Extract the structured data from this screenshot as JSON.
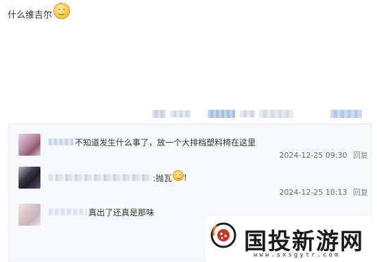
{
  "post": {
    "text": "什么维吉尔",
    "emoji_icon": "smiley-icon"
  },
  "comments": [
    {
      "text": "不知道发生什么事了，放一个大排档塑料椅在这里",
      "timestamp": "2024-12-25 09:30",
      "reply_label": "回复"
    },
    {
      "text": ":抛瓦",
      "text_after_emoji": "!",
      "timestamp": "2024-12-25 10:13",
      "reply_label": "回复"
    },
    {
      "text": "真出了还真是那味"
    }
  ],
  "watermark": {
    "brand": "国投新游网",
    "url": "www.sxsgytr.com"
  },
  "colors": {
    "comment_bg": "#f7f8fa",
    "text": "#333333",
    "meta": "#666666"
  }
}
